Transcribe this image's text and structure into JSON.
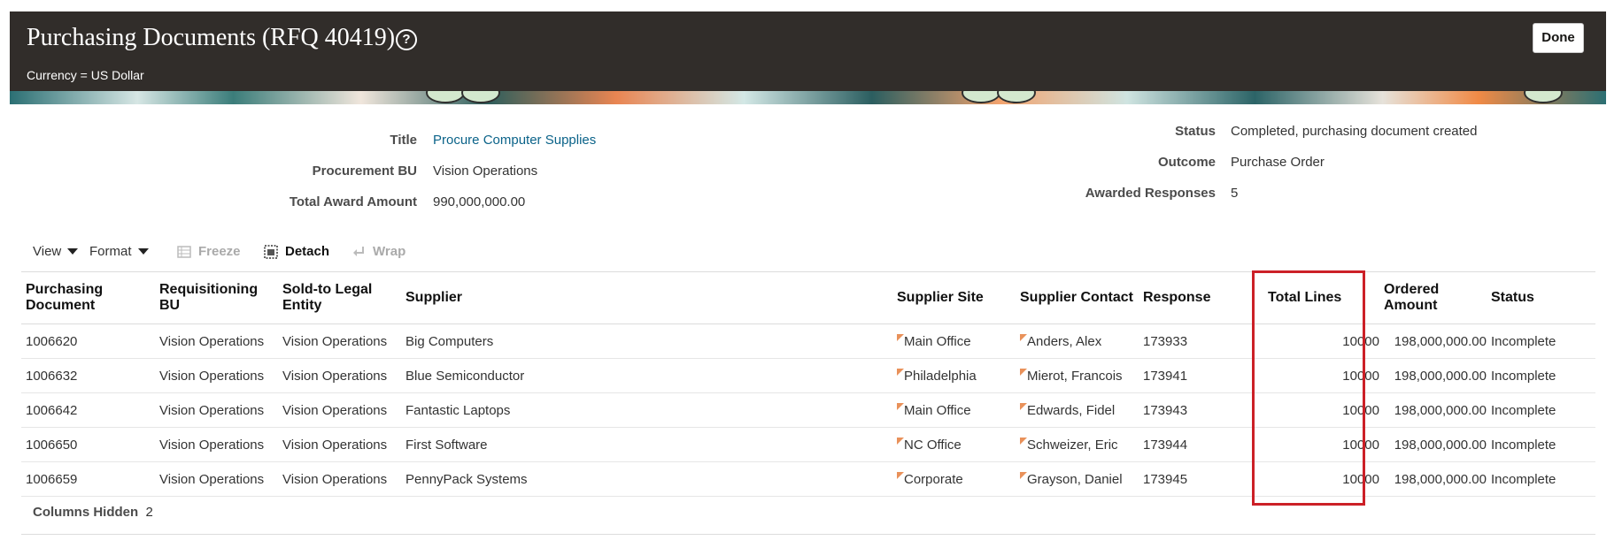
{
  "header": {
    "title": "Purchasing Documents (RFQ 40419)",
    "help_glyph": "?",
    "currency": "Currency = US Dollar",
    "done_label": "Done"
  },
  "summary": {
    "title_label": "Title",
    "title_value": "Procure Computer Supplies",
    "bu_label": "Procurement BU",
    "bu_value": "Vision Operations",
    "award_label": "Total Award Amount",
    "award_value": "990,000,000.00",
    "status_label": "Status",
    "status_value": "Completed, purchasing document created",
    "outcome_label": "Outcome",
    "outcome_value": "Purchase Order",
    "awarded_label": "Awarded Responses",
    "awarded_value": "5"
  },
  "toolbar": {
    "view": "View",
    "format": "Format",
    "freeze": "Freeze",
    "detach": "Detach",
    "wrap": "Wrap"
  },
  "table": {
    "columns": [
      "Purchasing Document",
      "Requisitioning BU",
      "Sold-to Legal Entity",
      "Supplier",
      "Supplier Site",
      "Supplier Contact",
      "Response",
      "Total Lines",
      "Ordered Amount",
      "Status"
    ],
    "rows": [
      [
        "1006620",
        "Vision Operations",
        "Vision Operations",
        "Big Computers",
        "Main Office",
        "Anders, Alex",
        "173933",
        "10000",
        "198,000,000.00",
        "Incomplete"
      ],
      [
        "1006632",
        "Vision Operations",
        "Vision Operations",
        "Blue Semiconductor",
        "Philadelphia",
        "Mierot, Francois",
        "173941",
        "10000",
        "198,000,000.00",
        "Incomplete"
      ],
      [
        "1006642",
        "Vision Operations",
        "Vision Operations",
        "Fantastic Laptops",
        "Main Office",
        "Edwards, Fidel",
        "173943",
        "10000",
        "198,000,000.00",
        "Incomplete"
      ],
      [
        "1006650",
        "Vision Operations",
        "Vision Operations",
        "First Software",
        "NC Office",
        "Schweizer, Eric",
        "173944",
        "10000",
        "198,000,000.00",
        "Incomplete"
      ],
      [
        "1006659",
        "Vision Operations",
        "Vision Operations",
        "PennyPack Systems",
        "Corporate",
        "Grayson, Daniel",
        "173945",
        "10000",
        "198,000,000.00",
        "Incomplete"
      ]
    ]
  },
  "footer": {
    "columns_hidden_label": "Columns Hidden",
    "columns_hidden_count": "2"
  },
  "colors": {
    "header_bg": "#312d2a",
    "link": "#0b6389",
    "highlight": "#cc2027",
    "flag": "#e9915a"
  }
}
